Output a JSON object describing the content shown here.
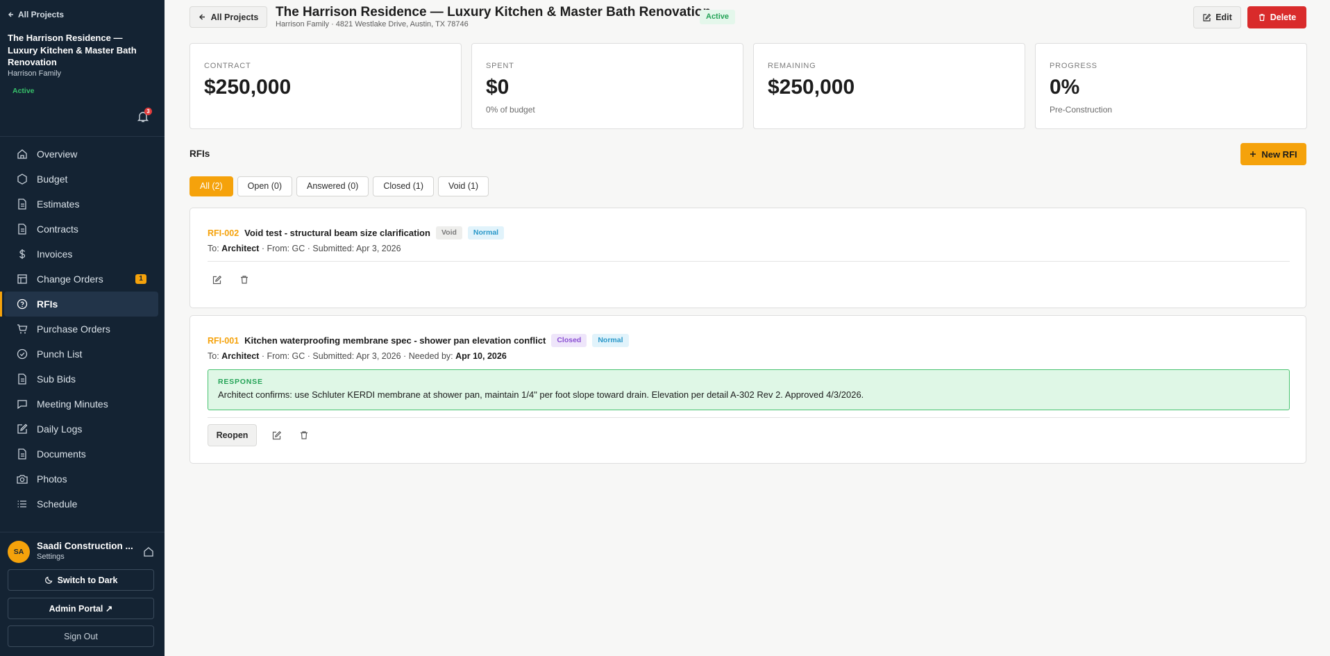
{
  "sidebar": {
    "back_label": "All Projects",
    "project_title": "The Harrison Residence — Luxury Kitchen & Master Bath Renovation",
    "client": "Harrison Family",
    "status": "Active",
    "notification_count": "3",
    "nav": [
      {
        "label": "Overview",
        "icon": "home-icon"
      },
      {
        "label": "Budget",
        "icon": "circle-icon"
      },
      {
        "label": "Estimates",
        "icon": "file-icon"
      },
      {
        "label": "Contracts",
        "icon": "file-icon"
      },
      {
        "label": "Invoices",
        "icon": "dollar-icon"
      },
      {
        "label": "Change Orders",
        "icon": "table-icon",
        "badge": "1"
      },
      {
        "label": "RFIs",
        "icon": "help-circle-icon",
        "active": true
      },
      {
        "label": "Purchase Orders",
        "icon": "cart-icon"
      },
      {
        "label": "Punch List",
        "icon": "check-circle-icon"
      },
      {
        "label": "Sub Bids",
        "icon": "file-icon"
      },
      {
        "label": "Meeting Minutes",
        "icon": "chat-icon"
      },
      {
        "label": "Daily Logs",
        "icon": "edit-icon"
      },
      {
        "label": "Documents",
        "icon": "file-icon"
      },
      {
        "label": "Photos",
        "icon": "camera-icon"
      },
      {
        "label": "Schedule",
        "icon": "list-icon"
      }
    ],
    "user_initials": "SA",
    "org_name": "Saadi Construction ...",
    "settings_label": "Settings",
    "theme_button": "Switch to Dark",
    "admin_button": "Admin Portal ↗",
    "signout_button": "Sign Out"
  },
  "header": {
    "back_label": "All Projects",
    "title": "The Harrison Residence — Luxury Kitchen & Master Bath Renovation",
    "status": "Active",
    "subtitle": "Harrison Family · 4821 Westlake Drive, Austin, TX 78746",
    "edit_label": "Edit",
    "delete_label": "Delete"
  },
  "stats": [
    {
      "label": "CONTRACT",
      "value": "$250,000",
      "sub": ""
    },
    {
      "label": "SPENT",
      "value": "$0",
      "sub": "0% of budget"
    },
    {
      "label": "REMAINING",
      "value": "$250,000",
      "sub": ""
    },
    {
      "label": "PROGRESS",
      "value": "0%",
      "sub": "Pre-Construction"
    }
  ],
  "rfis": {
    "section_title": "RFIs",
    "new_label": "New RFI",
    "tabs": [
      "All (2)",
      "Open (0)",
      "Answered (0)",
      "Closed (1)",
      "Void (1)"
    ],
    "items": [
      {
        "number": "RFI-002",
        "subject": "Void test - structural beam size clarification",
        "status": "Void",
        "priority": "Normal",
        "to_prefix": "To: ",
        "to": "Architect",
        "meta": " · From: GC · Submitted: Apr 3, 2026"
      },
      {
        "number": "RFI-001",
        "subject": "Kitchen waterproofing membrane spec - shower pan elevation conflict",
        "status": "Closed",
        "priority": "Normal",
        "to_prefix": "To: ",
        "to": "Architect",
        "meta": " · From: GC · Submitted: Apr 3, 2026 · Needed by: ",
        "needed_by": "Apr 10, 2026",
        "response_label": "RESPONSE",
        "response": "Architect confirms: use Schluter KERDI membrane at shower pan, maintain 1/4\" per foot slope toward drain. Elevation per detail A-302 Rev 2. Approved 4/3/2026.",
        "reopen_label": "Reopen"
      }
    ]
  }
}
